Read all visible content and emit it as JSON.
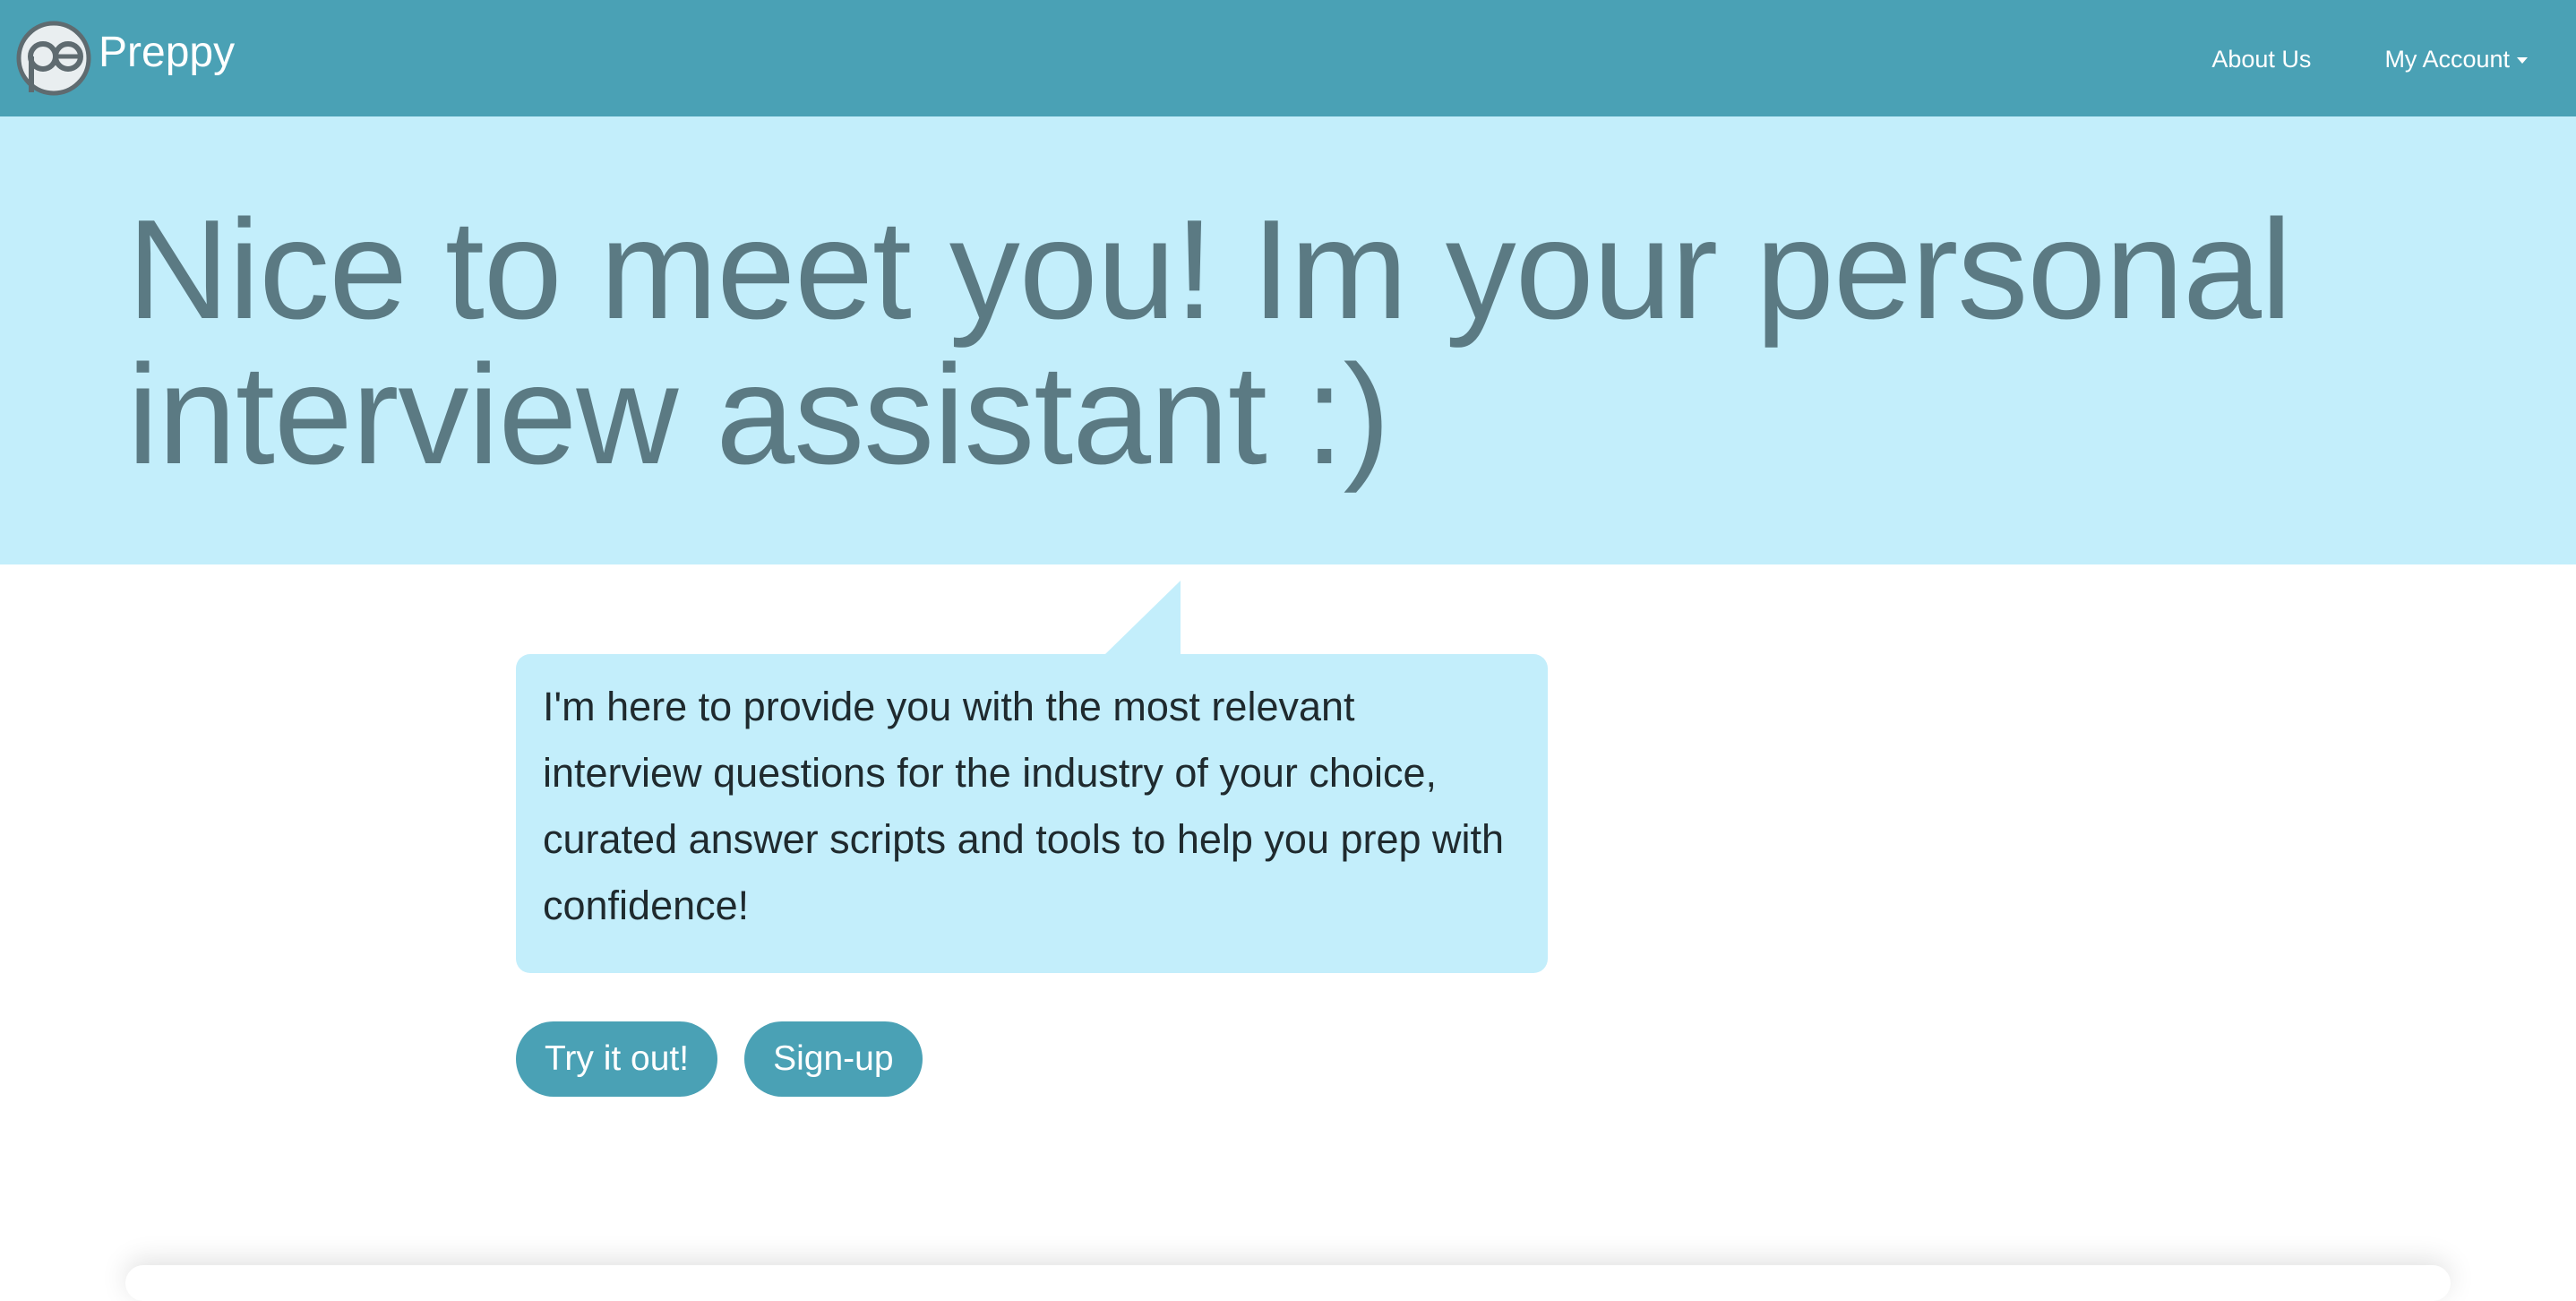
{
  "navbar": {
    "brand_name": "Preppy",
    "logo_icon": "preppy-logo-icon",
    "links": [
      {
        "label": "About Us"
      },
      {
        "label": "My Account",
        "has_dropdown": true
      }
    ]
  },
  "hero": {
    "title": "Nice to meet you! Im your personal interview assistant :)"
  },
  "bubble": {
    "text": "I'm here to provide you with the most relevant interview questions for the industry of your choice, curated answer scripts and tools to help you prep with confidence!"
  },
  "actions": {
    "try_label": "Try it out!",
    "signup_label": "Sign-up"
  },
  "colors": {
    "navbar": "#4aa1b5",
    "hero_background": "#c3eefb",
    "hero_text": "#5b7a83",
    "button": "#4aa1b5"
  }
}
